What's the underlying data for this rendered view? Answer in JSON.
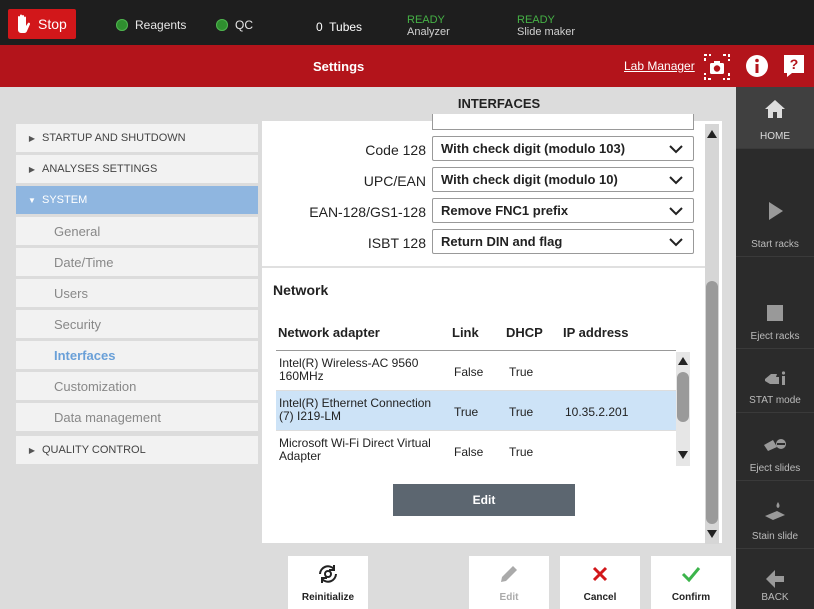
{
  "topbar": {
    "stop_label": "Stop",
    "reagents_label": "Reagents",
    "qc_label": "QC",
    "tubes_count": "0",
    "tubes_label": "Tubes",
    "analyzer_status": "READY",
    "analyzer_label": "Analyzer",
    "slide_maker_status": "READY",
    "slide_maker_label": "Slide maker",
    "status_color": "#46b246"
  },
  "header": {
    "title": "Settings",
    "lab_manager": "Lab Manager",
    "icons": [
      "camera-icon",
      "info-icon",
      "help-icon"
    ]
  },
  "sidebar": {
    "items": [
      {
        "label": "STARTUP AND SHUTDOWN"
      },
      {
        "label": "ANALYSES SETTINGS"
      },
      {
        "label": "SYSTEM"
      },
      {
        "label": "General"
      },
      {
        "label": "Date/Time"
      },
      {
        "label": "Users"
      },
      {
        "label": "Security"
      },
      {
        "label": "Interfaces"
      },
      {
        "label": "Customization"
      },
      {
        "label": "Data management"
      },
      {
        "label": "QUALITY CONTROL"
      }
    ],
    "active_color": "#8fb6e0"
  },
  "main": {
    "title": "INTERFACES",
    "barcodes": [
      {
        "label": "Code 128",
        "value": "With check digit (modulo 103)"
      },
      {
        "label": "UPC/EAN",
        "value": "With check digit (modulo 10)"
      },
      {
        "label": "EAN-128/GS1-128",
        "value": "Remove FNC1 prefix"
      },
      {
        "label": "ISBT 128",
        "value": "Return DIN and flag"
      }
    ],
    "network": {
      "title": "Network",
      "headers": {
        "adapter": "Network adapter",
        "link": "Link",
        "dhcp": "DHCP",
        "ip": "IP address"
      },
      "rows": [
        {
          "adapter": "Intel(R) Wireless-AC 9560 160MHz",
          "link": "False",
          "dhcp": "True",
          "ip": ""
        },
        {
          "adapter": "Intel(R) Ethernet Connection (7) I219-LM",
          "link": "True",
          "dhcp": "True",
          "ip": "10.35.2.201"
        },
        {
          "adapter": "Microsoft Wi-Fi Direct Virtual Adapter",
          "link": "False",
          "dhcp": "True",
          "ip": ""
        }
      ],
      "edit_label": "Edit"
    }
  },
  "toolbar": {
    "reinitialize": "Reinitialize",
    "edit": "Edit",
    "cancel": "Cancel",
    "confirm": "Confirm",
    "cancel_color": "#d2171a",
    "confirm_color": "#3cb44b"
  },
  "rail": {
    "home": "HOME",
    "start_racks": "Start racks",
    "eject_racks": "Eject racks",
    "stat_mode": "STAT mode",
    "eject_slides": "Eject slides",
    "stain_slide": "Stain slide",
    "back": "BACK"
  }
}
